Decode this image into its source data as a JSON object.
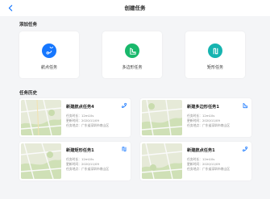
{
  "header": {
    "title": "创建任务",
    "back_icon": "chevron-left-icon"
  },
  "add_section": {
    "label": "添加任务",
    "cards": [
      {
        "label": "航点任务",
        "icon": "waypoint-route-icon",
        "color": "#1677ff"
      },
      {
        "label": "多边形任务",
        "icon": "polygon-task-icon",
        "color": "#19b86b"
      },
      {
        "label": "矩形任务",
        "icon": "rectangle-task-icon",
        "color": "#16b4b0"
      }
    ]
  },
  "history_section": {
    "label": "任务历史",
    "items": [
      {
        "name": "新建航点任务4",
        "duration": "任务时长：12m10s",
        "updated": "更新时间：2020/11/09",
        "location": "任务地点：广东省深圳市南山区",
        "icon": "waypoint-route-icon"
      },
      {
        "name": "新建多边形任务1",
        "duration": "任务时长：12m10s",
        "updated": "更新时间：2020/11/09",
        "location": "任务地点：广东省深圳市南山区",
        "icon": "polygon-task-icon"
      },
      {
        "name": "新建矩形任务1",
        "duration": "任务时长：12m10s",
        "updated": "更新时间：2020/11/09",
        "location": "任务地点：广东省深圳市南山区",
        "icon": "rectangle-task-icon"
      },
      {
        "name": "新建航点任务1",
        "duration": "任务时长：12m10s",
        "updated": "更新时间：2020/11/09",
        "location": "任务地点：广东省深圳市南山区",
        "icon": "waypoint-route-icon"
      }
    ]
  },
  "colors": {
    "accent": "#1677ff",
    "green": "#19b86b",
    "teal": "#16b4b0"
  }
}
